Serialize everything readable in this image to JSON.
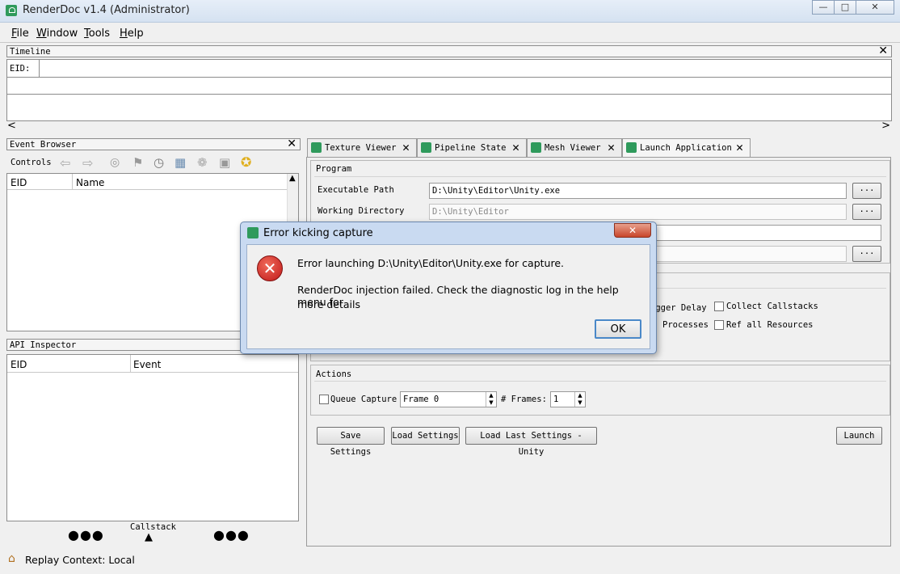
{
  "window": {
    "title": "RenderDoc v1.4 (Administrator)",
    "controls": [
      "minimize",
      "maximize",
      "close"
    ]
  },
  "menu": [
    "File",
    "Window",
    "Tools",
    "Help"
  ],
  "timeline": {
    "title": "Timeline",
    "eid_label": "EID:"
  },
  "event_browser": {
    "title": "Event Browser",
    "controls_label": "Controls",
    "columns": [
      "EID",
      "Name"
    ]
  },
  "api_inspector": {
    "title": "API Inspector",
    "columns": [
      "EID",
      "Event"
    ],
    "callstack_label": "Callstack"
  },
  "tabs": [
    "Texture Viewer",
    "Pipeline State",
    "Mesh Viewer",
    "Launch Application"
  ],
  "program": {
    "title": "Program",
    "exe_label": "Executable Path",
    "exe_value": "D:\\Unity\\Editor\\Unity.exe",
    "wd_label": "Working Directory",
    "wd_value": "D:\\Unity\\Editor",
    "browse": "..."
  },
  "options": {
    "debugger_delay": "ugger Delay",
    "collect_callstacks": "Collect Callstacks",
    "child_processes": "Processes",
    "ref_all_resources": "Ref all Resources"
  },
  "actions": {
    "title": "Actions",
    "queue_capture": "Queue Capture",
    "frame_value": "Frame 0",
    "frames_label": "# Frames:",
    "frames_value": "1"
  },
  "buttons": {
    "save_settings": "Save Settings",
    "load_settings": "Load Settings",
    "load_last": "Load Last Settings - Unity",
    "launch": "Launch"
  },
  "status": {
    "text": "Replay Context: Local"
  },
  "dialog": {
    "title": "Error kicking capture",
    "line1": "Error launching D:\\Unity\\Editor\\Unity.exe for capture.",
    "line2": "RenderDoc injection failed. Check the diagnostic log in the help menu for",
    "line3": "more details",
    "ok": "OK"
  }
}
